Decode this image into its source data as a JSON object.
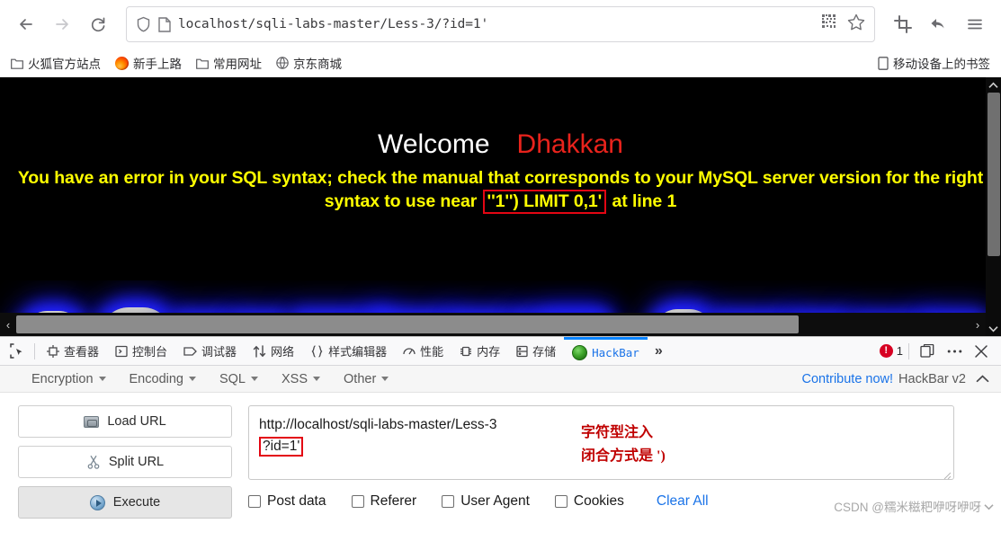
{
  "browser": {
    "back_label": "Back",
    "forward_label": "Forward",
    "reload_label": "Reload",
    "url_prefix": "localhost",
    "url_path": "/sqli-labs-master/Less-3/?id=1'",
    "url_full": "localhost/sqli-labs-master/Less-3/?id=1'",
    "qr_label": "QR code",
    "bookmark_star_label": "Bookmark this page",
    "screenshot_label": "Take a screenshot",
    "undo_label": "Undo",
    "menu_label": "Open application menu"
  },
  "bookmarks": {
    "items": [
      {
        "label": "火狐官方站点",
        "icon": "folder-icon"
      },
      {
        "label": "新手上路",
        "icon": "firefox-icon"
      },
      {
        "label": "常用网址",
        "icon": "folder-icon"
      },
      {
        "label": "京东商城",
        "icon": "globe-icon"
      }
    ],
    "mobile_label": "移动设备上的书签"
  },
  "page": {
    "welcome": "Welcome",
    "brand": "Dhakkan",
    "error_pre": "You have an error in your SQL syntax; check the manual that corresponds to your MySQL server version for the right syntax to use near ",
    "error_highlight": "''1'') LIMIT 0,1'",
    "error_post": " at line 1"
  },
  "devtools": {
    "picker_label": "Pick an element from the page",
    "tabs": [
      {
        "label": "查看器",
        "icon": "inspector-icon",
        "active": false
      },
      {
        "label": "控制台",
        "icon": "console-icon",
        "active": false
      },
      {
        "label": "调试器",
        "icon": "debugger-icon",
        "active": false
      },
      {
        "label": "网络",
        "icon": "network-icon",
        "active": false
      },
      {
        "label": "样式编辑器",
        "icon": "style-editor-icon",
        "active": false
      },
      {
        "label": "性能",
        "icon": "performance-icon",
        "active": false
      },
      {
        "label": "内存",
        "icon": "memory-icon",
        "active": false
      },
      {
        "label": "存储",
        "icon": "storage-icon",
        "active": false
      },
      {
        "label": "HackBar",
        "icon": "hackbar-icon",
        "active": true
      }
    ],
    "overflow_label": "»",
    "error_count": "1",
    "dock_label": "Dock toolbox",
    "meatball_label": "Customize DevTools",
    "close_label": "Close DevTools"
  },
  "hackbar": {
    "menu": [
      {
        "label": "Encryption"
      },
      {
        "label": "Encoding"
      },
      {
        "label": "SQL"
      },
      {
        "label": "XSS"
      },
      {
        "label": "Other"
      }
    ],
    "contribute_label": "Contribute now!",
    "version_label": "HackBar v2",
    "collapse_label": "Collapse",
    "buttons": [
      {
        "label": "Load URL",
        "icon": "load-url-icon"
      },
      {
        "label": "Split URL",
        "icon": "scissors-icon"
      },
      {
        "label": "Execute",
        "icon": "play-icon"
      }
    ],
    "url_line1": "http://localhost/sqli-labs-master/Less-3",
    "url_line2": "?id=1'",
    "annotation_line1": "字符型注入",
    "annotation_line2": "闭合方式是  ')",
    "checkboxes": [
      {
        "label": "Post data",
        "checked": false
      },
      {
        "label": "Referer",
        "checked": false
      },
      {
        "label": "User Agent",
        "checked": false
      },
      {
        "label": "Cookies",
        "checked": false
      }
    ],
    "clear_all_label": "Clear All"
  },
  "watermark": {
    "text": "CSDN @糯米糍粑咿呀咿呀"
  },
  "colors": {
    "accent_blue": "#0a84ff",
    "link_blue": "#1a73e8",
    "error_yellow": "#ffff00",
    "highlight_red": "#e30613",
    "brand_red": "#e8231c",
    "annotation_red": "#c00000"
  }
}
